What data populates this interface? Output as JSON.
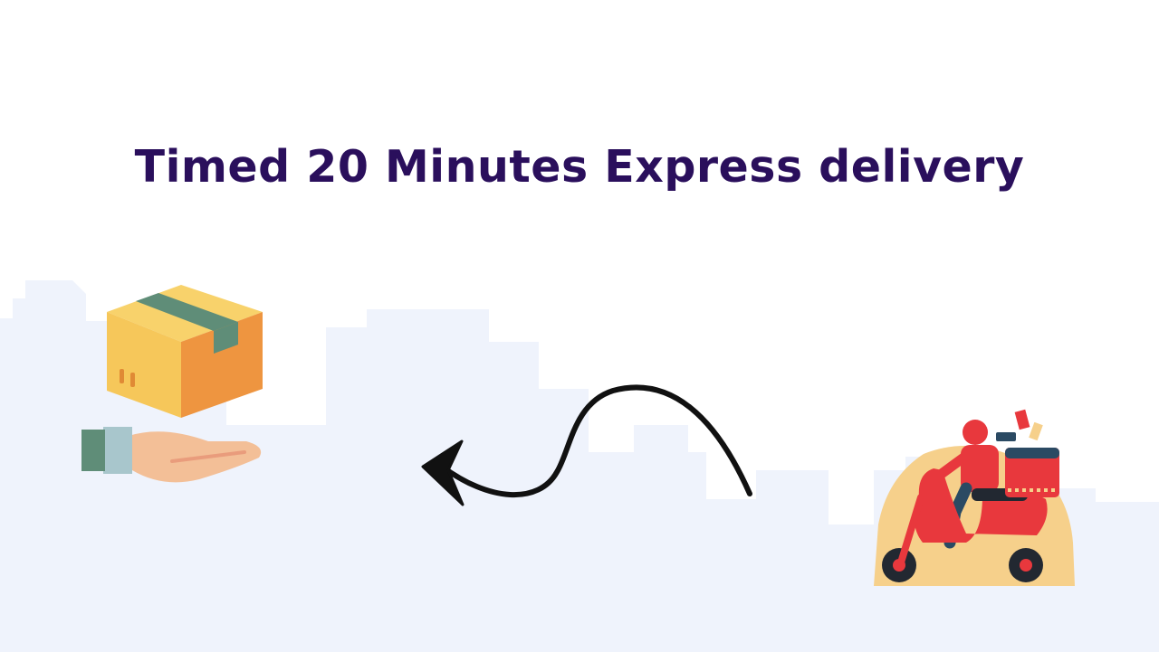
{
  "title": "Timed 20 Minutes Express delivery",
  "colors": {
    "title": "#2a0f5c",
    "skyline": "#eff3fc",
    "box_light": "#f6c75a",
    "box_dark": "#ee9540",
    "tape": "#5f8d78",
    "hand": "#f3bf97",
    "sleeve": "#5f8d78",
    "cuff": "#a8c6cc",
    "arrow": "#111111",
    "scooter": "#e8383d",
    "splash": "#f6d08b"
  },
  "icons": [
    "package-in-hand-icon",
    "curved-arrow-icon",
    "delivery-scooter-icon"
  ]
}
